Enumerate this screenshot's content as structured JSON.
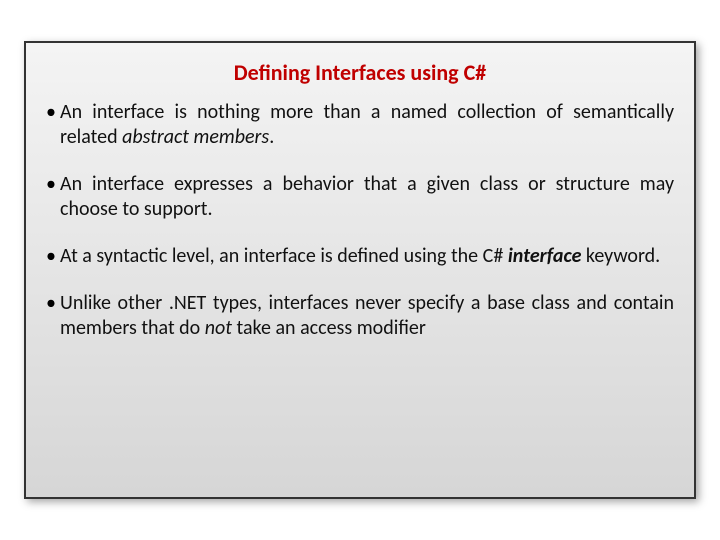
{
  "title": "Defining Interfaces using C#",
  "bullets": [
    {
      "pre": "An interface is nothing more than a named collection of semantically related ",
      "em": "abstract members",
      "emClass": "i",
      "post": "."
    },
    {
      "pre": "An interface expresses a behavior that a given class or structure may choose to support.",
      "em": "",
      "emClass": "",
      "post": ""
    },
    {
      "pre": "At a syntactic level, an interface is defined using the C# ",
      "em": "interface",
      "emClass": "bi",
      "post": " keyword."
    },
    {
      "pre": "Unlike other .NET types, interfaces never specify a base class and contain members that do ",
      "em": "not",
      "emClass": "i",
      "post": " take an access modifier"
    }
  ]
}
